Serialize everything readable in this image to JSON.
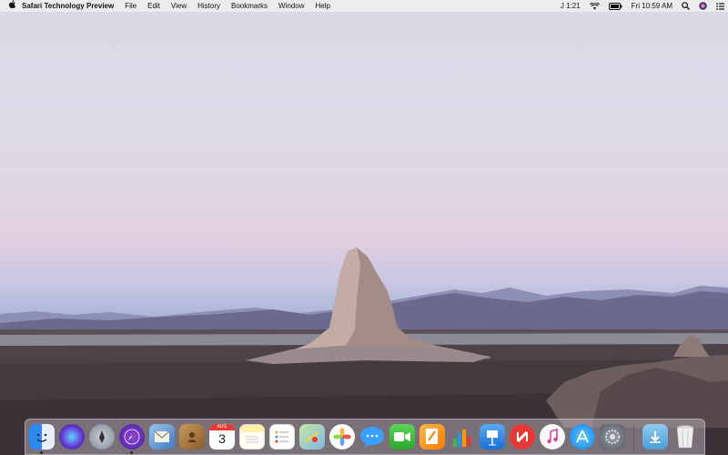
{
  "menubar": {
    "apple_icon": "apple-icon",
    "app_name": "Safari Technology Preview",
    "menus": [
      "File",
      "Edit",
      "View",
      "History",
      "Bookmarks",
      "Window",
      "Help"
    ],
    "status_user": "J 1:21",
    "wifi_icon": "wifi-icon",
    "battery_icon": "battery-icon",
    "clock": "Fri 10:59 AM",
    "spotlight_icon": "search-icon",
    "siri_icon": "siri-icon",
    "notification_icon": "list-icon"
  },
  "dock": {
    "calendar_month": "AUG",
    "calendar_day": "3",
    "apps": [
      "Finder",
      "Siri",
      "Launchpad",
      "Safari Technology Preview",
      "Mail",
      "Contacts",
      "Calendar",
      "Notes",
      "Reminders",
      "Maps",
      "Photos",
      "Messages",
      "FaceTime",
      "Pages",
      "Numbers",
      "Keynote",
      "News",
      "iTunes",
      "App Store",
      "System Preferences",
      "Downloads",
      "Trash"
    ]
  }
}
